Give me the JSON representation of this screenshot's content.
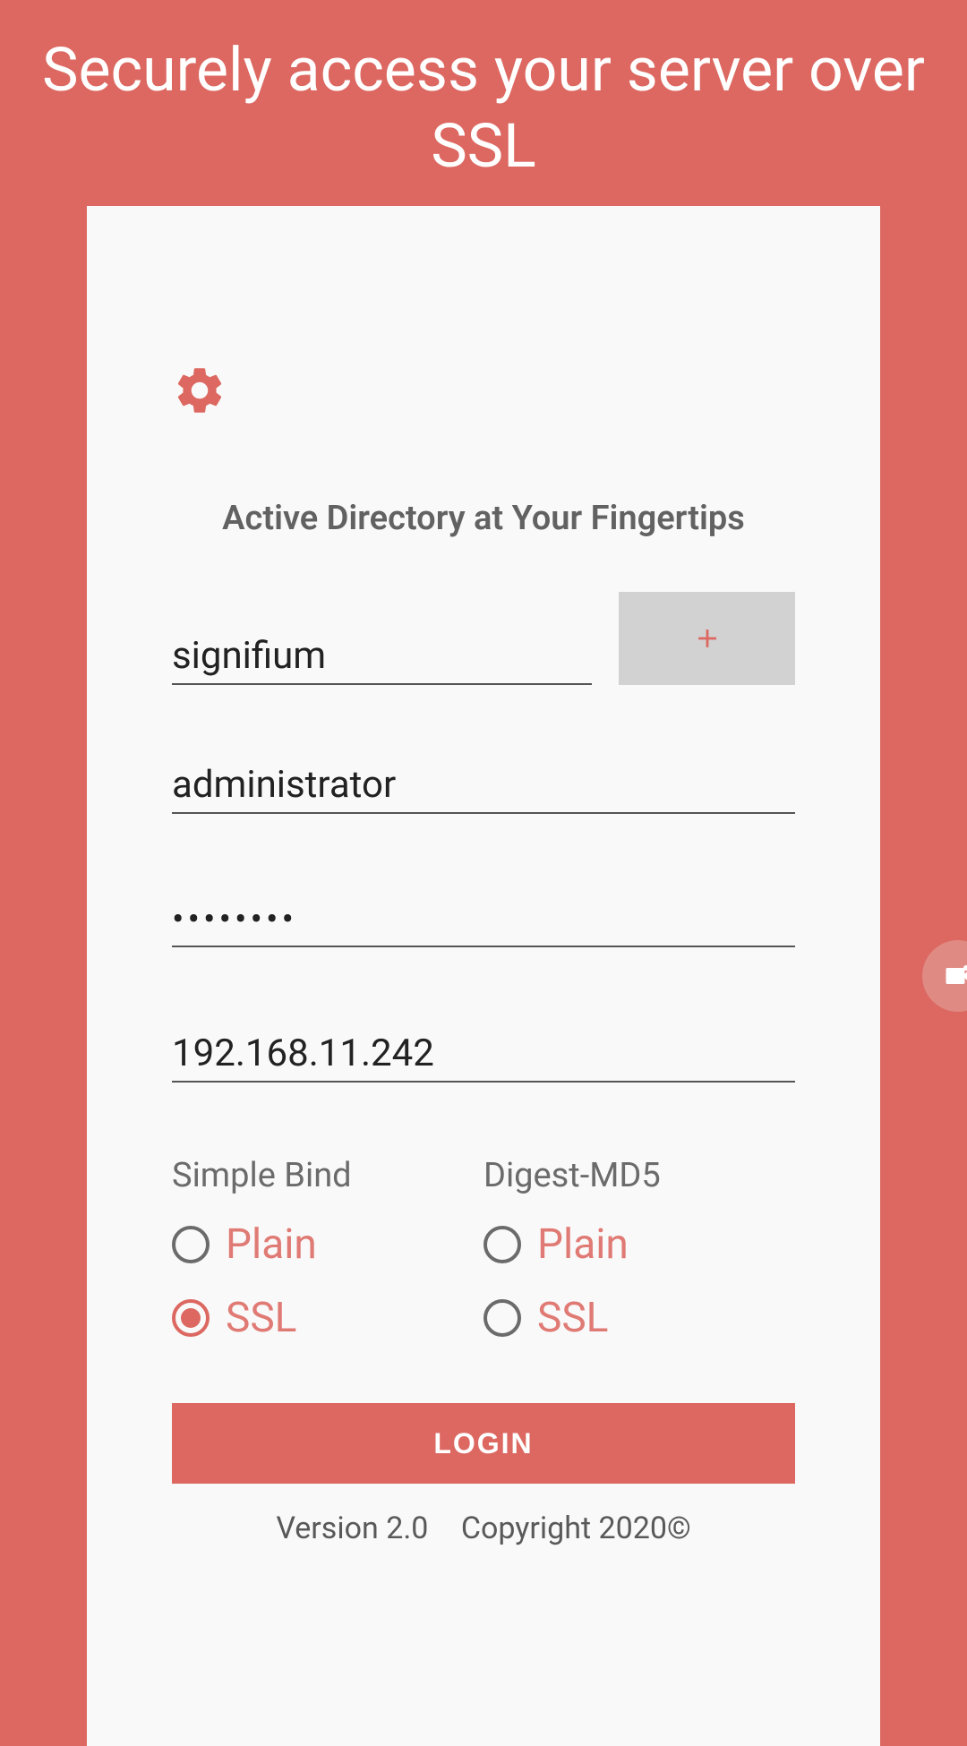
{
  "header": {
    "title": "Securely access your server over SSL"
  },
  "form": {
    "tagline": "Active Directory at Your Fingertips",
    "domain_value": "signifium",
    "username_value": "administrator",
    "password_display": "••••••••",
    "server_value": "192.168.11.242",
    "simple_bind_label": "Simple Bind",
    "digest_md5_label": "Digest-MD5",
    "option_plain": "Plain",
    "option_ssl": "SSL",
    "login_label": "LOGIN"
  },
  "footer": {
    "version": "Version 2.0",
    "copyright": "Copyright 2020©"
  },
  "colors": {
    "accent": "#DC6861"
  }
}
